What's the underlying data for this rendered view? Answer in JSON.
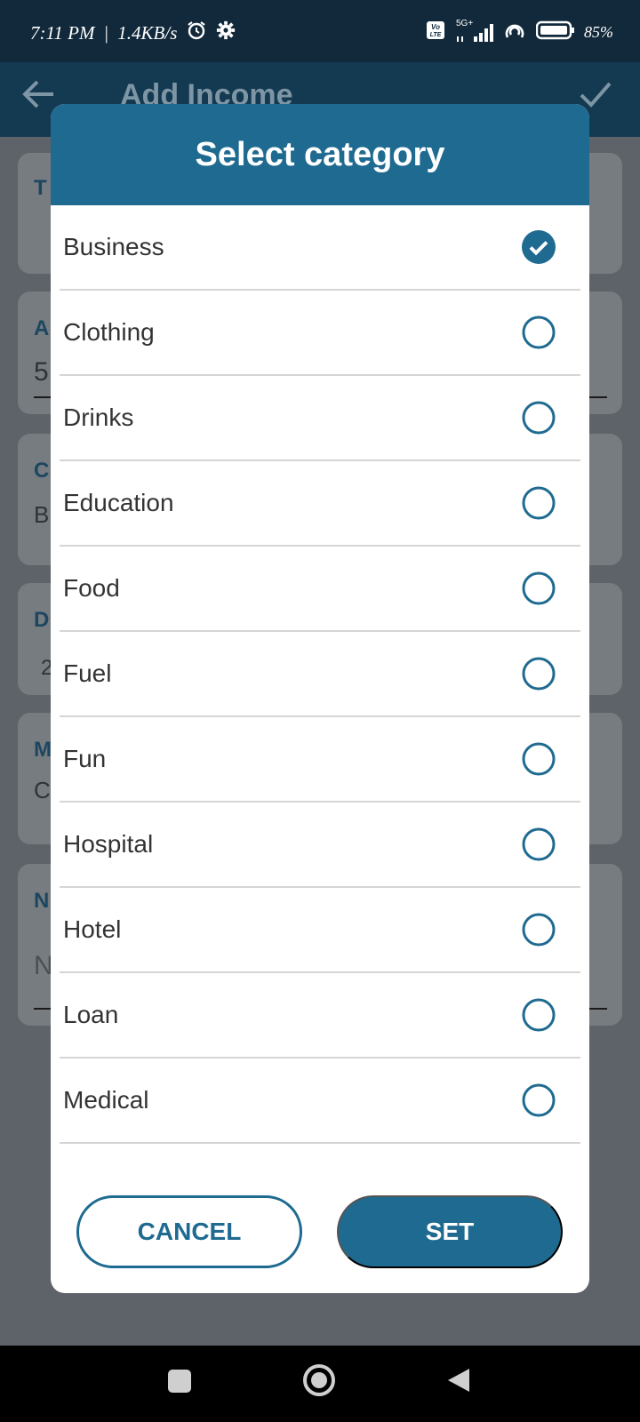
{
  "status_bar": {
    "time": "7:11 PM",
    "separator": "|",
    "speed": "1.4KB/s",
    "network": "5G+",
    "volte": "Vo LTE",
    "battery": "85%",
    "icons": [
      "alarm-icon",
      "gear-icon",
      "volte-icon",
      "signal-icon",
      "hotspot-icon",
      "battery-icon"
    ]
  },
  "app_bar": {
    "title": "Add Income",
    "icons": [
      "back-arrow-icon",
      "checkmark-icon"
    ]
  },
  "background_form": {
    "letters": [
      "T",
      "A",
      "C",
      "D",
      "M",
      "N"
    ],
    "values": [
      "5",
      "B",
      "2",
      "C",
      "N"
    ]
  },
  "dialog": {
    "title": "Select category",
    "selected": "Business",
    "items": [
      {
        "label": "Business",
        "selected": true
      },
      {
        "label": "Clothing",
        "selected": false
      },
      {
        "label": "Drinks",
        "selected": false
      },
      {
        "label": "Education",
        "selected": false
      },
      {
        "label": "Food",
        "selected": false
      },
      {
        "label": "Fuel",
        "selected": false
      },
      {
        "label": "Fun",
        "selected": false
      },
      {
        "label": "Hospital",
        "selected": false
      },
      {
        "label": "Hotel",
        "selected": false
      },
      {
        "label": "Loan",
        "selected": false
      },
      {
        "label": "Medical",
        "selected": false
      }
    ],
    "cancel_label": "CANCEL",
    "set_label": "SET"
  },
  "nav_bar": {
    "icons": [
      "recents-square-icon",
      "home-circle-icon",
      "back-triangle-icon"
    ]
  },
  "colors": {
    "primary": "#1f6a90",
    "status_bar": "#11293a",
    "scrim": "#5d6368"
  }
}
